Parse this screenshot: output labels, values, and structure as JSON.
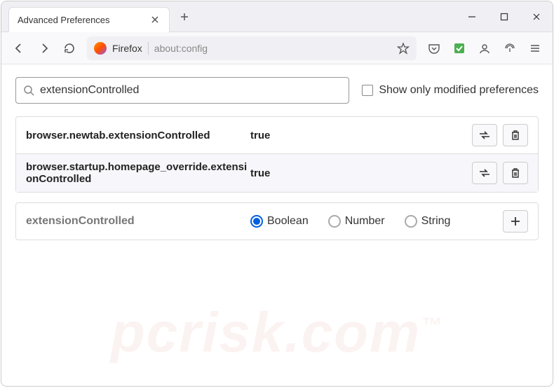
{
  "titlebar": {
    "tab_title": "Advanced Preferences"
  },
  "toolbar": {
    "firefox_label": "Firefox",
    "url": "about:config"
  },
  "search": {
    "value": "extensionControlled",
    "placeholder": "",
    "checkbox_label": "Show only modified preferences"
  },
  "prefs": [
    {
      "name": "browser.newtab.extensionControlled",
      "value": "true"
    },
    {
      "name": "browser.startup.homepage_override.extensionControlled",
      "value": "true"
    }
  ],
  "create": {
    "name": "extensionControlled",
    "types": [
      "Boolean",
      "Number",
      "String"
    ],
    "selected": "Boolean"
  },
  "watermark": "pcrisk.com"
}
